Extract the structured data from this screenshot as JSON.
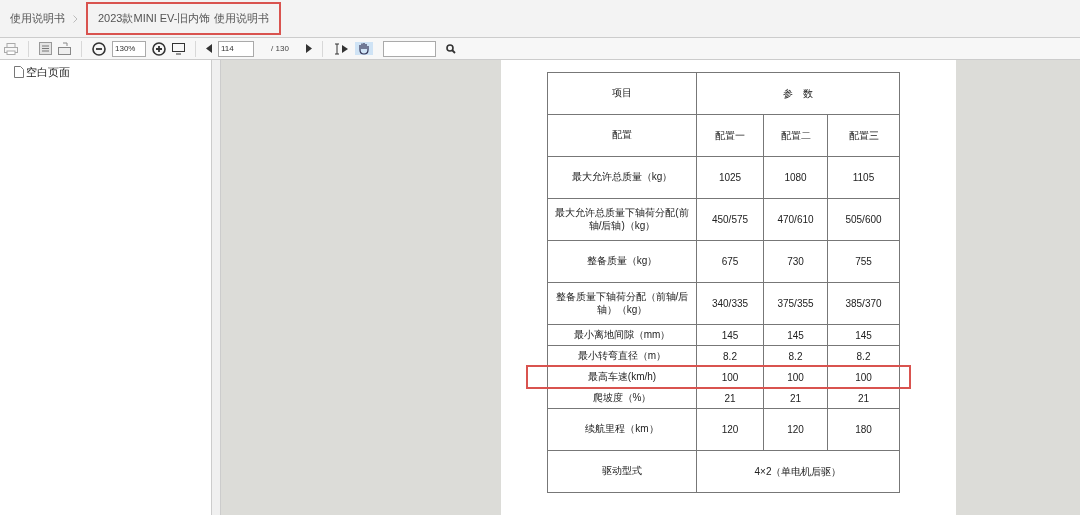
{
  "breadcrumb": [
    {
      "label": "使用说明书",
      "highlighted": false
    },
    {
      "label": "2023款MINI EV-旧内饰 使用说明书",
      "highlighted": true
    }
  ],
  "toolbar": {
    "zoom": "130%",
    "page": "114",
    "page_total": "/ 130",
    "hand_tool_selected": true
  },
  "outline": {
    "items": [
      {
        "label": "空白页面"
      }
    ]
  },
  "table": {
    "rows": [
      {
        "label": "项目",
        "values": [
          "参　数"
        ],
        "highlighted": false
      },
      {
        "label": "配置",
        "values": [
          "配置一",
          "配置二",
          "配置三"
        ],
        "highlighted": false
      },
      {
        "label": "最大允许总质量（kg）",
        "values": [
          "1025",
          "1080",
          "1105"
        ],
        "highlighted": false
      },
      {
        "label": "最大允许总质量下轴荷分配(前轴/后轴)（kg）",
        "values": [
          "450/575",
          "470/610",
          "505/600"
        ],
        "highlighted": false
      },
      {
        "label": "整备质量（kg）",
        "values": [
          "675",
          "730",
          "755"
        ],
        "highlighted": false
      },
      {
        "label": "整备质量下轴荷分配（前轴/后轴）（kg）",
        "values": [
          "340/335",
          "375/355",
          "385/370"
        ],
        "highlighted": false
      },
      {
        "label": "最小离地间隙（mm）",
        "values": [
          "145",
          "145",
          "145"
        ],
        "highlighted": false
      },
      {
        "label": "最小转弯直径（m）",
        "values": [
          "8.2",
          "8.2",
          "8.2"
        ],
        "highlighted": false
      },
      {
        "label": "最高车速(km/h)",
        "values": [
          "100",
          "100",
          "100"
        ],
        "highlighted": true
      },
      {
        "label": "爬坡度（%）",
        "values": [
          "21",
          "21",
          "21"
        ],
        "highlighted": false
      },
      {
        "label": "续航里程（km）",
        "values": [
          "120",
          "120",
          "180"
        ],
        "highlighted": false
      },
      {
        "label": "驱动型式",
        "values": [
          "4×2（单电机后驱）"
        ],
        "highlighted": false
      }
    ]
  }
}
